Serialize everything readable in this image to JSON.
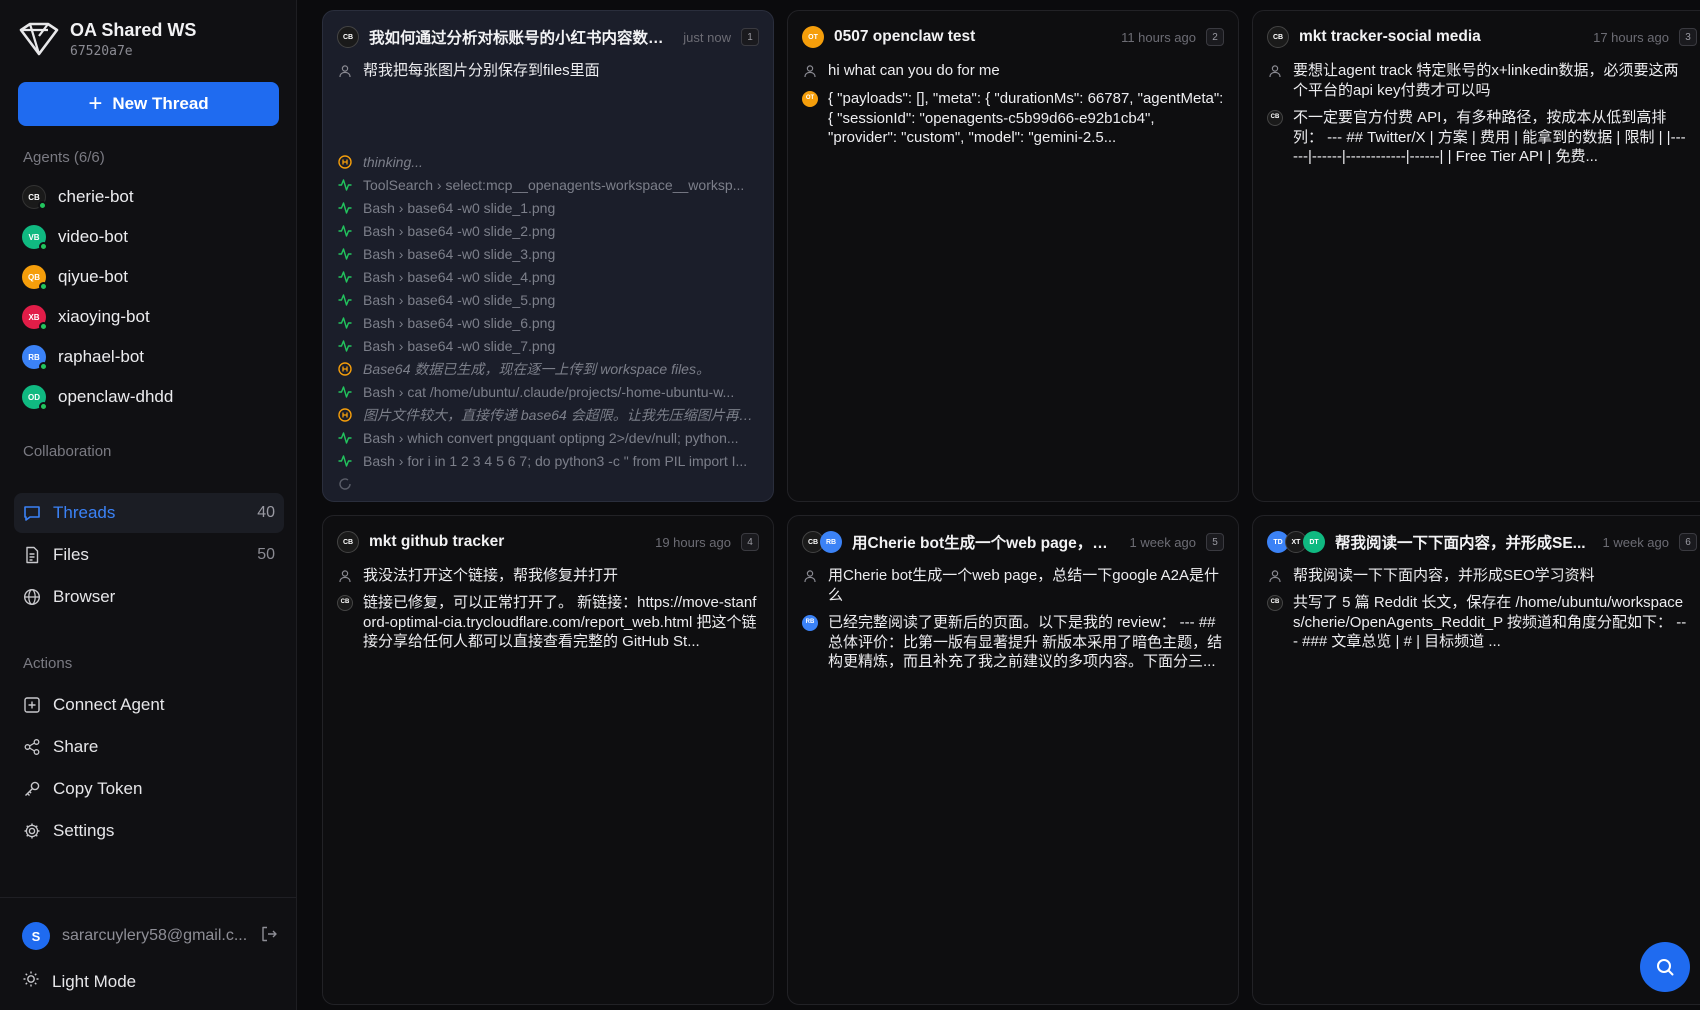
{
  "workspace": {
    "name": "OA Shared WS",
    "id": "67520a7e",
    "logo_icon": "logo-icon"
  },
  "new_thread_label": "New Thread",
  "agents": {
    "label": "Agents (6/6)",
    "items": [
      {
        "initials": "CB",
        "name": "cherie-bot",
        "color": "#1a1a1a"
      },
      {
        "initials": "VB",
        "name": "video-bot",
        "color": "#10b981"
      },
      {
        "initials": "QB",
        "name": "qiyue-bot",
        "color": "#f59e0b"
      },
      {
        "initials": "XB",
        "name": "xiaoying-bot",
        "color": "#e11d48"
      },
      {
        "initials": "RB",
        "name": "raphael-bot",
        "color": "#3b82f6"
      },
      {
        "initials": "OD",
        "name": "openclaw-dhdd",
        "color": "#10b981"
      }
    ]
  },
  "collaboration": {
    "label": "Collaboration",
    "items": [
      {
        "label": "Threads",
        "count": "40",
        "icon": "chat-icon"
      },
      {
        "label": "Files",
        "count": "50",
        "icon": "file-icon"
      },
      {
        "label": "Browser",
        "count": "",
        "icon": "globe-icon"
      }
    ]
  },
  "actions": {
    "label": "Actions",
    "items": [
      {
        "label": "Connect Agent",
        "icon": "plus-square-icon"
      },
      {
        "label": "Share",
        "icon": "share-icon"
      },
      {
        "label": "Copy Token",
        "icon": "key-icon"
      },
      {
        "label": "Settings",
        "icon": "gear-icon"
      }
    ]
  },
  "user": {
    "initial": "S",
    "email": "sararcuylery58@gmail.c..."
  },
  "light_mode_label": "Light Mode",
  "colors": {
    "accent": "#1f6bf0",
    "online": "#22c55e",
    "thinking": "#f59e0b",
    "tool": "#22c55e"
  },
  "threads": [
    {
      "title": "我如何通过分析对标账号的小红书内容数据...",
      "time": "just now",
      "num": "1",
      "user_msg": "帮我把每张图片分别保存到files里面",
      "trace": [
        {
          "kind": "thinking",
          "text": "thinking..."
        },
        {
          "kind": "tool",
          "text": "ToolSearch › select:mcp__openagents-workspace__worksp..."
        },
        {
          "kind": "tool",
          "text": "Bash › base64 -w0 slide_1.png"
        },
        {
          "kind": "tool",
          "text": "Bash › base64 -w0 slide_2.png"
        },
        {
          "kind": "tool",
          "text": "Bash › base64 -w0 slide_3.png"
        },
        {
          "kind": "tool",
          "text": "Bash › base64 -w0 slide_4.png"
        },
        {
          "kind": "tool",
          "text": "Bash › base64 -w0 slide_5.png"
        },
        {
          "kind": "tool",
          "text": "Bash › base64 -w0 slide_6.png"
        },
        {
          "kind": "tool",
          "text": "Bash › base64 -w0 slide_7.png"
        },
        {
          "kind": "thinking",
          "text": "Base64 数据已生成，现在逐一上传到 workspace files。"
        },
        {
          "kind": "tool",
          "text": "Bash › cat /home/ubuntu/.claude/projects/-home-ubuntu-w..."
        },
        {
          "kind": "thinking",
          "text": "图片文件较大，直接传递 base64 会超限。让我先压缩图片再上..."
        },
        {
          "kind": "tool",
          "text": "Bash › which convert pngquant optipng 2>/dev/null; python..."
        },
        {
          "kind": "tool",
          "text": "Bash › for i in 1 2 3 4 5 6 7; do python3 -c \" from PIL import I..."
        }
      ]
    },
    {
      "title": "0507 openclaw test",
      "time": "11 hours ago",
      "num": "2",
      "user_msg": "hi what can you do for me",
      "reply": "{ \"payloads\": [], \"meta\": { \"durationMs\": 66787, \"agentMeta\": { \"sessionId\": \"openagents-c5b99d66-e92b1cb4\", \"provider\": \"custom\", \"model\": \"gemini-2.5..."
    },
    {
      "title": "mkt tracker-social media",
      "time": "17 hours ago",
      "num": "3",
      "user_msg": "要想让agent track 特定账号的x+linkedin数据，必须要这两个平台的api key付费才可以吗",
      "reply": "不一定要官方付费 API，有多种路径，按成本从低到高排列： --- ## Twitter/X | 方案 | 费用 | 能拿到的数据 | 限制 | |------|------|------------|------| | Free Tier API | 免费..."
    },
    {
      "title": "mkt github tracker",
      "time": "19 hours ago",
      "num": "4",
      "user_msg": "我没法打开这个链接，帮我修复并打开",
      "reply": "链接已修复，可以正常打开了。 新链接：https://move-stanford-optimal-cia.trycloudflare.com/report_web.html 把这个链接分享给任何人都可以直接查看完整的 GitHub St..."
    },
    {
      "title": "用Cherie bot生成一个web page，总...",
      "time": "1 week ago",
      "num": "5",
      "user_msg": "用Cherie bot生成一个web page，总结一下google A2A是什么",
      "reply": "已经完整阅读了更新后的页面。以下是我的 review： --- ## 总体评价：比第一版有显著提升 新版本采用了暗色主题，结构更精炼，而且补充了我之前建议的多项内容。下面分三..."
    },
    {
      "title": "帮我阅读一下下面内容，并形成SE...",
      "time": "1 week ago",
      "num": "6",
      "user_msg": "帮我阅读一下下面内容，并形成SEO学习资料",
      "reply": "共写了 5 篇 Reddit 长文，保存在 /home/ubuntu/workspaces/cherie/OpenAgents_Reddit_P 按频道和角度分配如下： --- ### 文章总览 | # | 目标频道 ..."
    }
  ],
  "avatars": {
    "cb": "CB",
    "ot": "OT",
    "rb": "RB",
    "td": "TD",
    "xt": "XT",
    "dt": "DT"
  }
}
